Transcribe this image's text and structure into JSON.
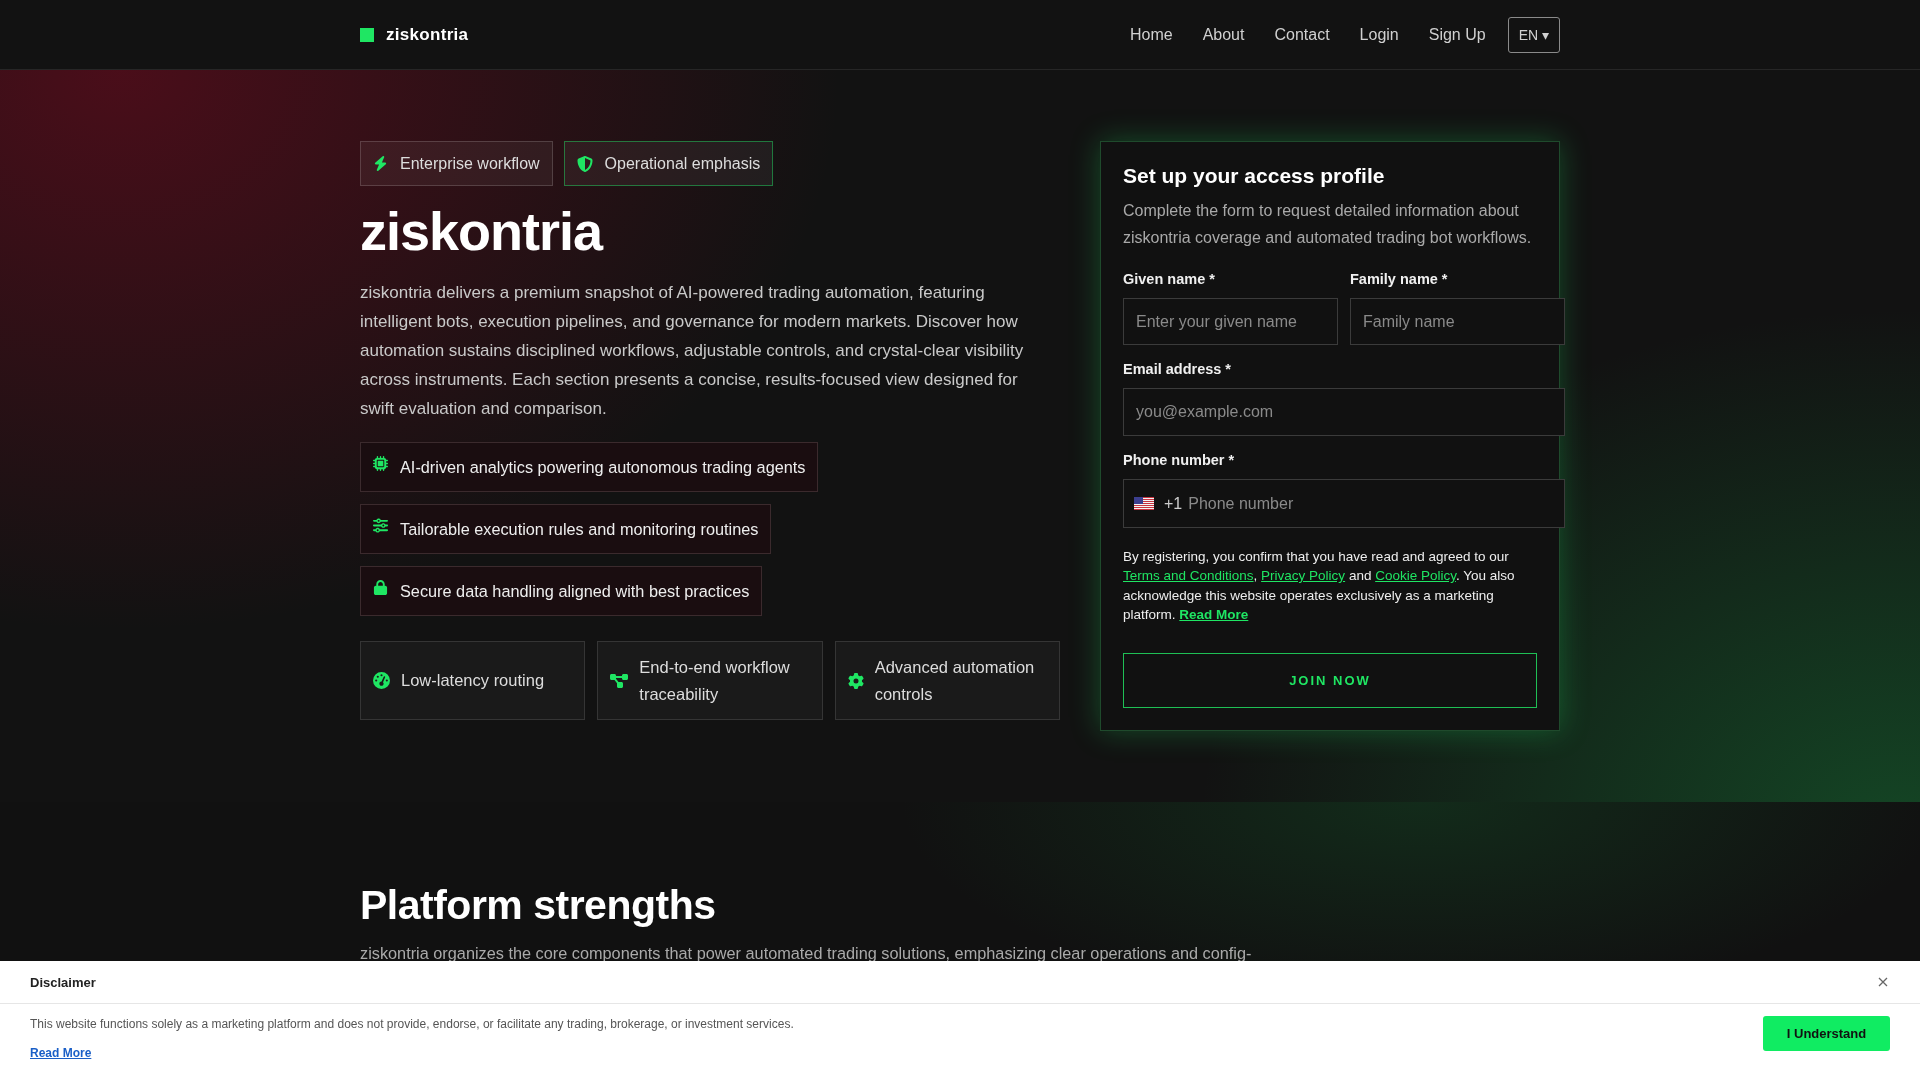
{
  "header": {
    "brand": "ziskontria",
    "nav": [
      "Home",
      "About",
      "Contact",
      "Login",
      "Sign Up"
    ],
    "language": "EN ▾"
  },
  "hero": {
    "badges": [
      {
        "label": "Enterprise workflow",
        "accent": false
      },
      {
        "label": "Operational emphasis",
        "accent": true
      }
    ],
    "title": "ziskontria",
    "description": "ziskontria delivers a premium snapshot of AI-powered trading automation, featuring intelligent bots, execution pipelines, and governance for modern markets. Discover how automation sustains disciplined workflows, adjustable controls, and crystal-clear visibility across instruments. Each section presents a concise, results-focused view designed for swift evaluation and comparison.",
    "features": [
      "AI-driven analytics powering autonomous trading agents",
      "Tailorable execution rules and monitoring routines",
      "Secure data handling aligned with best practices"
    ],
    "cards": [
      "Low-latency routing",
      "End-to-end workflow traceability",
      "Advanced automation controls"
    ]
  },
  "form": {
    "title": "Set up your access profile",
    "subtitle": "Complete the form to request detailed information about ziskontria coverage and automated trading bot workflows.",
    "given_name": {
      "label": "Given name *",
      "placeholder": "Enter your given name"
    },
    "family_name": {
      "label": "Family name *",
      "placeholder": "Family name"
    },
    "email": {
      "label": "Email address *",
      "placeholder": "you@example.com"
    },
    "phone": {
      "label": "Phone number *",
      "country_code": "+1",
      "placeholder": "Phone number"
    },
    "consent": [
      {
        "kind": "text",
        "text": "By registering, you confirm that you have read and agreed to our "
      },
      {
        "kind": "link",
        "text": "Terms and Conditions"
      },
      {
        "kind": "text",
        "text": ", "
      },
      {
        "kind": "link",
        "text": "Privacy Policy"
      },
      {
        "kind": "text",
        "text": " and "
      },
      {
        "kind": "link",
        "text": "Cookie Policy"
      },
      {
        "kind": "text",
        "text": ". You also acknowledge this website operates exclusively as a marketing platform. "
      },
      {
        "kind": "strong_link",
        "text": "Read More"
      }
    ],
    "submit": "JOIN NOW"
  },
  "strengths": {
    "title": "Platform strengths",
    "intro": "ziskontria organizes the core components that power automated trading solutions, emphasizing clear operations and config-"
  },
  "disclaimer": {
    "title": "Disclaimer",
    "text": "This website functions solely as a marketing platform and does not provide, endorse, or facilitate any trading, brokerage, or investment services.",
    "link": "Read More",
    "button": "I Understand"
  }
}
